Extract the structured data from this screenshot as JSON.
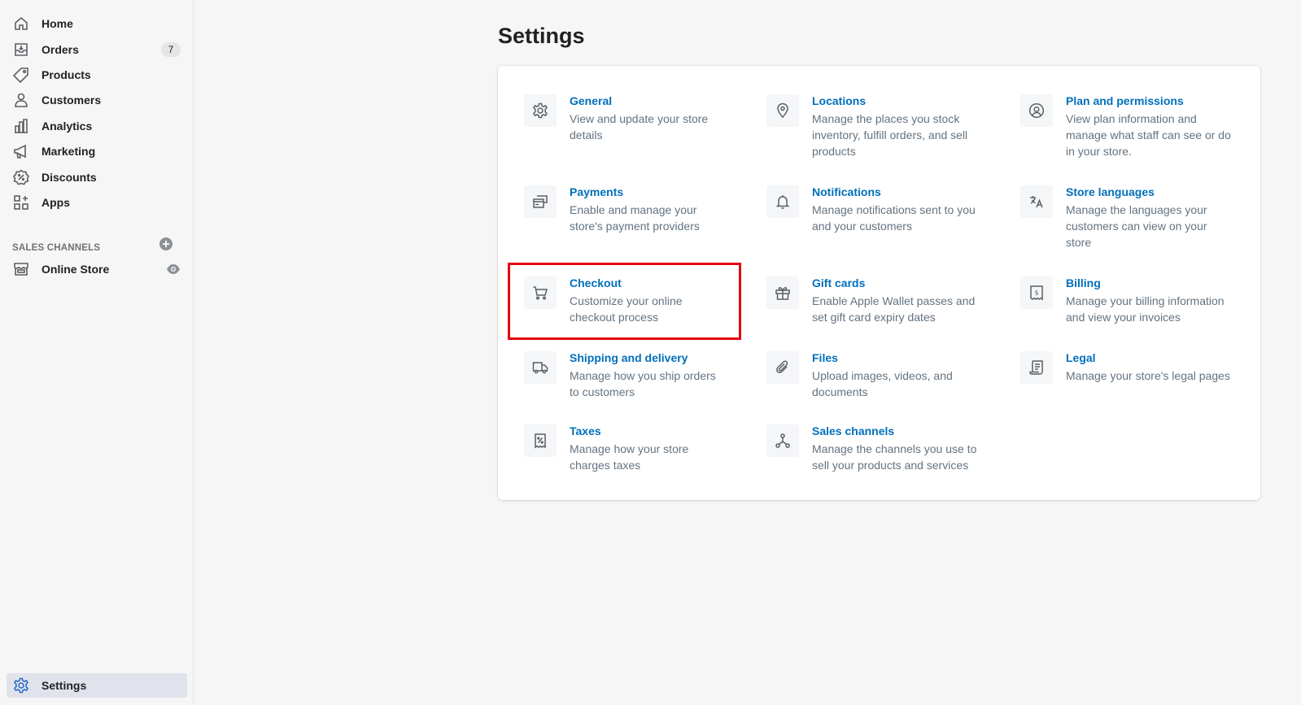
{
  "sidebar": {
    "items": [
      {
        "label": "Home",
        "icon": "home-icon"
      },
      {
        "label": "Orders",
        "icon": "orders-icon",
        "badge": "7"
      },
      {
        "label": "Products",
        "icon": "tag-icon"
      },
      {
        "label": "Customers",
        "icon": "person-icon"
      },
      {
        "label": "Analytics",
        "icon": "bar-chart-icon"
      },
      {
        "label": "Marketing",
        "icon": "megaphone-icon"
      },
      {
        "label": "Discounts",
        "icon": "discount-icon"
      },
      {
        "label": "Apps",
        "icon": "apps-icon"
      }
    ],
    "sales_channels_title": "SALES CHANNELS",
    "online_store": "Online Store",
    "settings": "Settings"
  },
  "page": {
    "title": "Settings"
  },
  "settings": [
    {
      "title": "General",
      "desc": "View and update your store details",
      "icon": "gear-icon"
    },
    {
      "title": "Locations",
      "desc": "Manage the places you stock inventory, fulfill orders, and sell products",
      "icon": "location-pin-icon"
    },
    {
      "title": "Plan and permissions",
      "desc": "View plan information and manage what staff can see or do in your store.",
      "icon": "profile-circle-icon"
    },
    {
      "title": "Payments",
      "desc": "Enable and manage your store's payment providers",
      "icon": "payments-icon"
    },
    {
      "title": "Notifications",
      "desc": "Manage notifications sent to you and your customers",
      "icon": "bell-icon"
    },
    {
      "title": "Store languages",
      "desc": "Manage the languages your customers can view on your store",
      "icon": "translate-icon"
    },
    {
      "title": "Checkout",
      "desc": "Customize your online checkout process",
      "icon": "cart-icon"
    },
    {
      "title": "Gift cards",
      "desc": "Enable Apple Wallet passes and set gift card expiry dates",
      "icon": "gift-icon"
    },
    {
      "title": "Billing",
      "desc": "Manage your billing information and view your invoices",
      "icon": "billing-icon"
    },
    {
      "title": "Shipping and delivery",
      "desc": "Manage how you ship orders to customers",
      "icon": "truck-icon"
    },
    {
      "title": "Files",
      "desc": "Upload images, videos, and documents",
      "icon": "paperclip-icon"
    },
    {
      "title": "Legal",
      "desc": "Manage your store's legal pages",
      "icon": "legal-document-icon"
    },
    {
      "title": "Taxes",
      "desc": "Manage how your store charges taxes",
      "icon": "tax-icon"
    },
    {
      "title": "Sales channels",
      "desc": "Manage the channels you use to sell your products and services",
      "icon": "channels-icon"
    }
  ],
  "colors": {
    "link": "#006fbb",
    "highlight": "#e3000f",
    "icon": "#5c5f62"
  }
}
